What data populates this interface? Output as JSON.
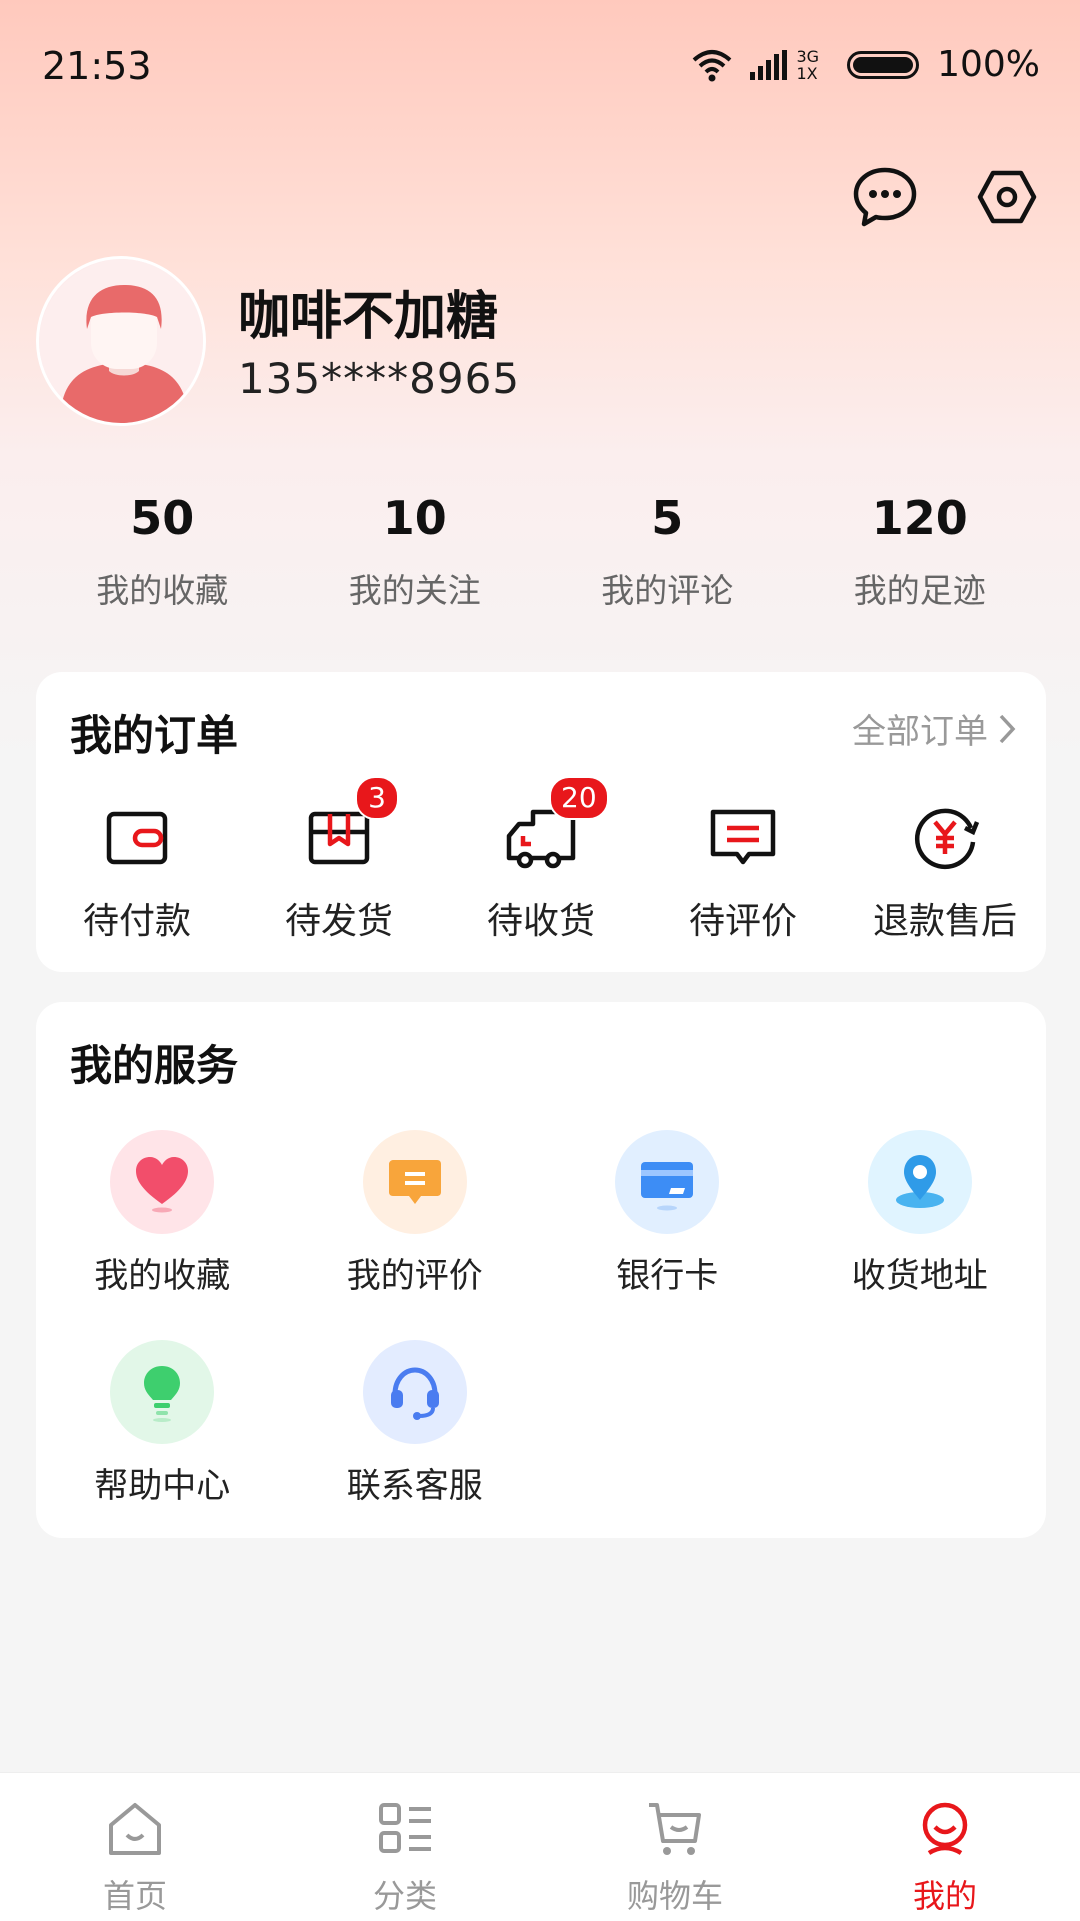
{
  "status_bar": {
    "time": "21:53",
    "network": "3G",
    "network2": "1X",
    "battery": "100%"
  },
  "header": {
    "chat_icon": "chat-bubble-icon",
    "settings_icon": "settings-hex-icon"
  },
  "profile": {
    "nickname": "咖啡不加糖",
    "phone": "135****8965"
  },
  "stats": [
    {
      "value": "50",
      "label": "我的收藏"
    },
    {
      "value": "10",
      "label": "我的关注"
    },
    {
      "value": "5",
      "label": "我的评论"
    },
    {
      "value": "120",
      "label": "我的足迹"
    }
  ],
  "orders": {
    "title": "我的订单",
    "all_link": "全部订单",
    "items": [
      {
        "label": "待付款",
        "badge": ""
      },
      {
        "label": "待发货",
        "badge": "3"
      },
      {
        "label": "待收货",
        "badge": "20"
      },
      {
        "label": "待评价",
        "badge": ""
      },
      {
        "label": "退款售后",
        "badge": ""
      }
    ]
  },
  "services": {
    "title": "我的服务",
    "items": [
      {
        "label": "我的收藏"
      },
      {
        "label": "我的评价"
      },
      {
        "label": "银行卡"
      },
      {
        "label": "收货地址"
      },
      {
        "label": "帮助中心"
      },
      {
        "label": "联系客服"
      }
    ]
  },
  "tabbar": {
    "items": [
      {
        "label": "首页"
      },
      {
        "label": "分类"
      },
      {
        "label": "购物车"
      },
      {
        "label": "我的"
      }
    ],
    "active": "我的"
  },
  "colors": {
    "accent": "#e8171b",
    "gradient_top": "#ffc9bd"
  }
}
